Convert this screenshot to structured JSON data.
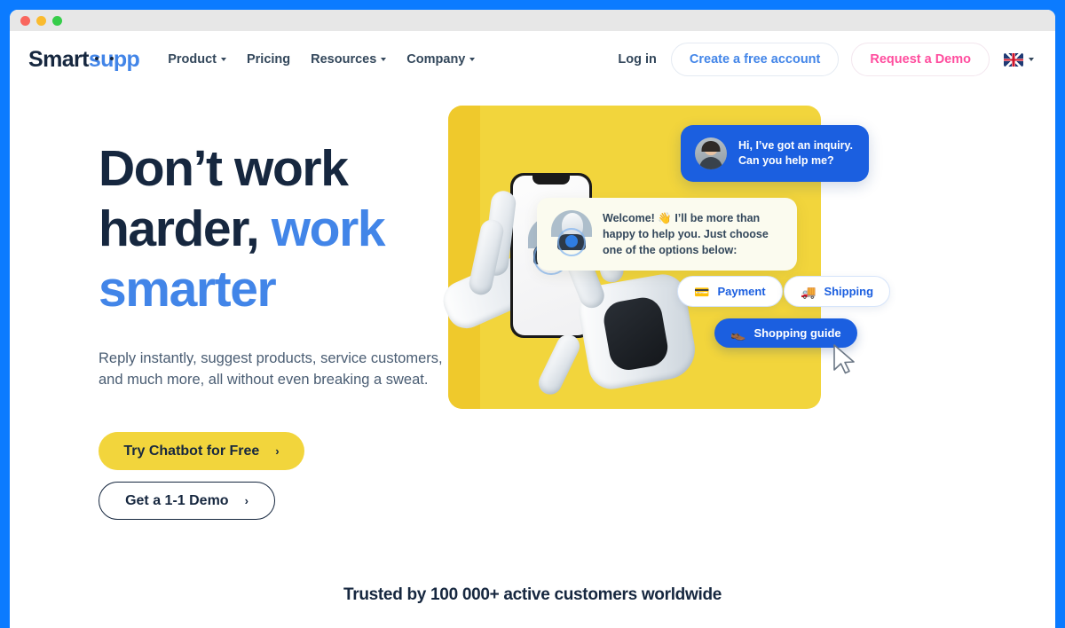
{
  "browser": {
    "traffic_lights": [
      "red",
      "yellow",
      "green"
    ]
  },
  "navbar": {
    "logo": {
      "part1": "Smart",
      "part2": "supp"
    },
    "menu": [
      {
        "label": "Product",
        "has_caret": true
      },
      {
        "label": "Pricing",
        "has_caret": false
      },
      {
        "label": "Resources",
        "has_caret": true
      },
      {
        "label": "Company",
        "has_caret": true
      }
    ],
    "login_label": "Log in",
    "create_account_label": "Create a free account",
    "request_demo_label": "Request a Demo",
    "language": "en-GB"
  },
  "hero": {
    "title_line1": "Don’t work",
    "title_line2a": "harder, ",
    "title_line2b": "work",
    "title_line3": "smarter",
    "subtitle": "Reply instantly, suggest products, service customers, and much more, all without even breaking a sweat.",
    "cta_primary": "Try Chatbot for Free",
    "cta_secondary": "Get a 1-1 Demo",
    "cta_arrow": "›"
  },
  "illustration": {
    "bubble_user": "Hi, I’ve got an inquiry. Can you help me?",
    "bubble_bot": "Welcome! 👋 I’ll be more than happy to help you. Just choose one of the options below:",
    "chips": [
      {
        "label": "Payment",
        "emoji": "💳",
        "style": "light"
      },
      {
        "label": "Shipping",
        "emoji": "🚚",
        "style": "light"
      },
      {
        "label": "Shopping guide",
        "emoji": "👞",
        "style": "primary"
      }
    ]
  },
  "trust": {
    "text": "Trusted by 100 000+ active customers worldwide"
  },
  "colors": {
    "frame_blue": "#0B7BFF",
    "accent_blue": "#4285E8",
    "brand_navy": "#16273F",
    "cta_yellow": "#F2D53C",
    "pink": "#FF4D9E",
    "bubble_blue": "#1B5FE0"
  }
}
